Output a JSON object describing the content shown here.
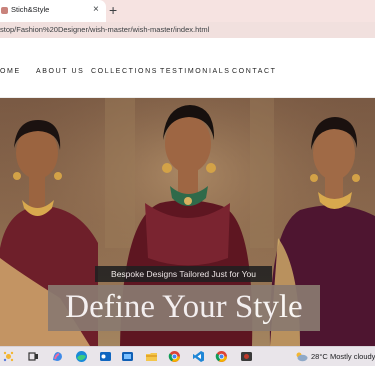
{
  "browser": {
    "tab_title": "Stich&Style",
    "tab_close_glyph": "×",
    "new_tab_glyph": "+",
    "url": "stop/Fashion%20Designer/wish-master/wish-master/index.html"
  },
  "nav": {
    "items": [
      "OME",
      "ABOUT US",
      "COLLECTIONS",
      "TESTIMONIALS",
      "CONTACT"
    ]
  },
  "hero": {
    "tagline": "Bespoke Designs Tailored Just for You",
    "headline": "Define Your Style"
  },
  "taskbar": {
    "icons": [
      "widgets-icon",
      "search-icon",
      "task-view-icon",
      "copilot-icon",
      "edge-icon",
      "outlook-icon",
      "file-explorer-icon",
      "chrome-icon",
      "vscode-icon",
      "chrome-icon",
      "media-icon"
    ],
    "weather": {
      "temperature": "28°C",
      "condition": "Mostly cloudy"
    }
  },
  "colors": {
    "tabstrip": "#f6e3e1",
    "address_bar": "#f1e0de",
    "tagline_box": "#202020",
    "headline_box": "#8a7a70",
    "taskbar": "#e9e5ea"
  }
}
